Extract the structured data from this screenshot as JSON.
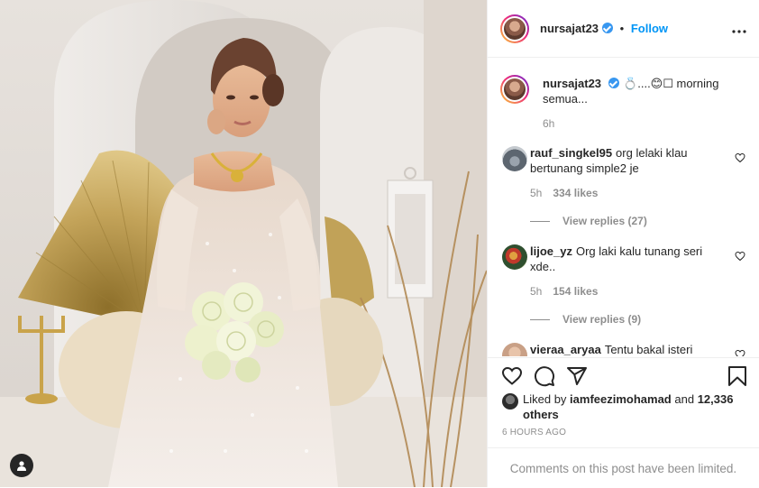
{
  "post": {
    "username": "nursajat23",
    "follow_label": "Follow",
    "separator": "•",
    "more_label": "•••"
  },
  "caption": {
    "username": "nursajat23",
    "text": "💍....😊☐ morning semua...",
    "age": "6h"
  },
  "comments": [
    {
      "username": "rauf_singkel95",
      "text": "org lelaki klau bertunang simple2 je",
      "age": "5h",
      "likes": "334 likes",
      "replies": "View replies (27)"
    },
    {
      "username": "lijoe_yz",
      "text": "Org laki kalu tunang seri xde..",
      "age": "5h",
      "likes": "154 likes",
      "replies": "View replies (9)"
    },
    {
      "username": "vieraa_aryaa",
      "text": "Tentu bakal isteri",
      "age": "",
      "likes": "",
      "replies": ""
    }
  ],
  "likes_summary": {
    "prefix": "Liked by",
    "user": "iamfeezimohamad",
    "conjunction": "and",
    "others": "12,336 others"
  },
  "timestamp": "6 HOURS AGO",
  "footer": {
    "limited_text": "Comments on this post have been limited."
  },
  "icons": {
    "like": "heart-icon",
    "comment": "comment-icon",
    "share": "share-icon",
    "save": "bookmark-icon",
    "tag": "user-tag-icon"
  },
  "colors": {
    "link": "#0095f6",
    "verified": "#3897f0",
    "secondary_text": "#8e8e8e",
    "border": "#efefef"
  }
}
